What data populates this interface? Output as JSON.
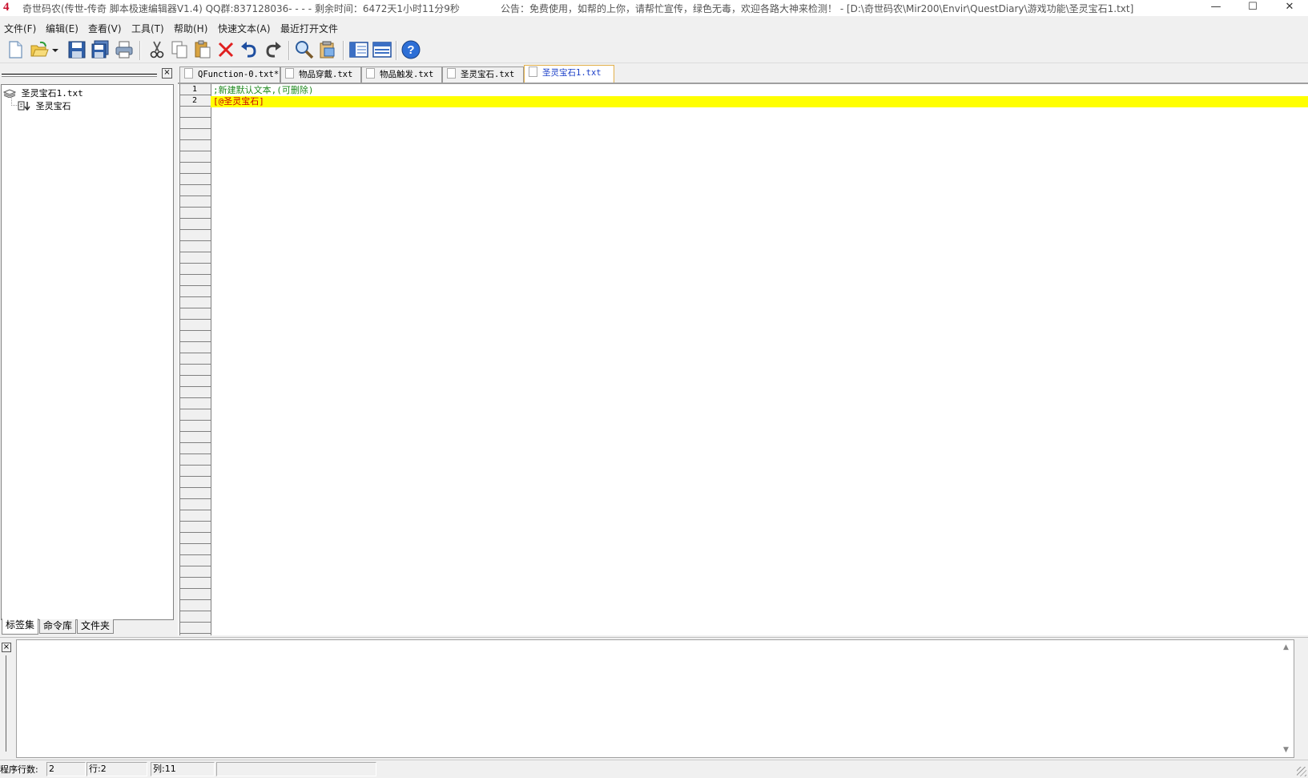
{
  "window": {
    "title": "奇世码农(传世-传奇 脚本极速编辑器V1.4) QQ群:837128036- - - - 剩余时间：6472天1小时11分9秒",
    "notice": "公告：免费使用，如帮的上你，请帮忙宣传，绿色无毒，欢迎各路大神来检测！  - [D:\\奇世码农\\Mir200\\Envir\\QuestDiary\\游戏功能\\圣灵宝石1.txt]",
    "minimize": "—",
    "maximize": "☐",
    "close": "✕"
  },
  "menu": [
    {
      "label": "文件(F)"
    },
    {
      "label": "编辑(E)"
    },
    {
      "label": "查看(V)"
    },
    {
      "label": "工具(T)"
    },
    {
      "label": "帮助(H)"
    },
    {
      "label": "快速文本(A)"
    },
    {
      "label": "最近打开文件"
    }
  ],
  "left_panel": {
    "close": "×",
    "tree_root": "圣灵宝石1.txt",
    "tree_child": "圣灵宝石",
    "tabs": [
      {
        "label": "标签集"
      },
      {
        "label": "命令库"
      },
      {
        "label": "文件夹"
      }
    ]
  },
  "editor_tabs": [
    {
      "label": "QFunction-0.txt*"
    },
    {
      "label": "物品穿戴.txt"
    },
    {
      "label": "物品触发.txt"
    },
    {
      "label": "圣灵宝石.txt"
    },
    {
      "label": "圣灵宝石1.txt"
    }
  ],
  "editor": {
    "lines": [
      {
        "num": "1",
        "text": ";新建默认文本,(可删除)"
      },
      {
        "num": "2",
        "text": "[@圣灵宝石]"
      }
    ]
  },
  "output": {
    "close": "×",
    "scroll_up": "▲",
    "scroll_down": "▼"
  },
  "status": {
    "program_lines_label": "程序行数:",
    "program_lines_value": "2",
    "row": "行:2",
    "col": "列:11"
  },
  "colors": {
    "comment": "#1f8a1f",
    "label_text": "#c80000",
    "current_line": "#ffff00",
    "active_tab_text": "#1a3ec8"
  }
}
